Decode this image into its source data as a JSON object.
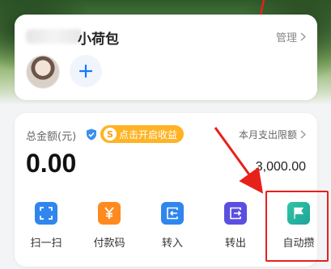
{
  "wallet": {
    "title": "小荷包",
    "manage_label": "管理"
  },
  "balance": {
    "total_label": "总金额(元)",
    "earn_badge_label": "点击开启收益",
    "earn_badge_coin": "S",
    "limit_label": "本月支出限额",
    "amount": "0.00",
    "limit_value": "3,000.00"
  },
  "actions": [
    {
      "label": "扫一扫",
      "icon": "scan-icon",
      "color": "#2f86ee"
    },
    {
      "label": "付款码",
      "icon": "yuan-icon",
      "color": "#ff8a1f"
    },
    {
      "label": "转入",
      "icon": "transfer-in-icon",
      "color": "#2f86ee"
    },
    {
      "label": "转出",
      "icon": "transfer-out-icon",
      "color": "#5a4fe0"
    },
    {
      "label": "自动攒",
      "icon": "flag-icon",
      "color": "#23b3a0"
    }
  ],
  "colors": {
    "accent_blue": "#1677ff",
    "badge_orange": "#ffb325",
    "annotation_red": "#e8201a"
  }
}
